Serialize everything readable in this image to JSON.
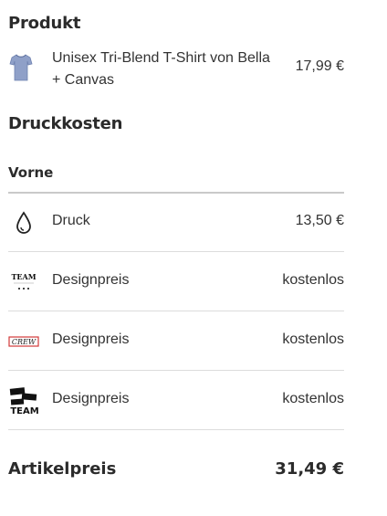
{
  "product_section": {
    "heading": "Produkt",
    "item": {
      "name": "Unisex Tri-Blend T-Shirt von Bella + Canvas",
      "price": "17,99 €",
      "icon": "tshirt-thumbnail"
    }
  },
  "print_costs": {
    "heading": "Druckkosten",
    "side": "Vorne",
    "rows": [
      {
        "label": "Druck",
        "value": "13,50 €",
        "icon": "droplet-icon"
      },
      {
        "label": "Designpreis",
        "value": "kostenlos",
        "icon": "team-logo-design"
      },
      {
        "label": "Designpreis",
        "value": "kostenlos",
        "icon": "crew-logo-design"
      },
      {
        "label": "Designpreis",
        "value": "kostenlos",
        "icon": "work-team-logo-design"
      }
    ]
  },
  "summary": {
    "label": "Artikelpreis",
    "price": "31,49 €"
  },
  "colors": {
    "text": "#2b2b2b",
    "rule": "#dcdcdc",
    "shirt": "#8fa0c8",
    "crew_red": "#d23a3a"
  }
}
